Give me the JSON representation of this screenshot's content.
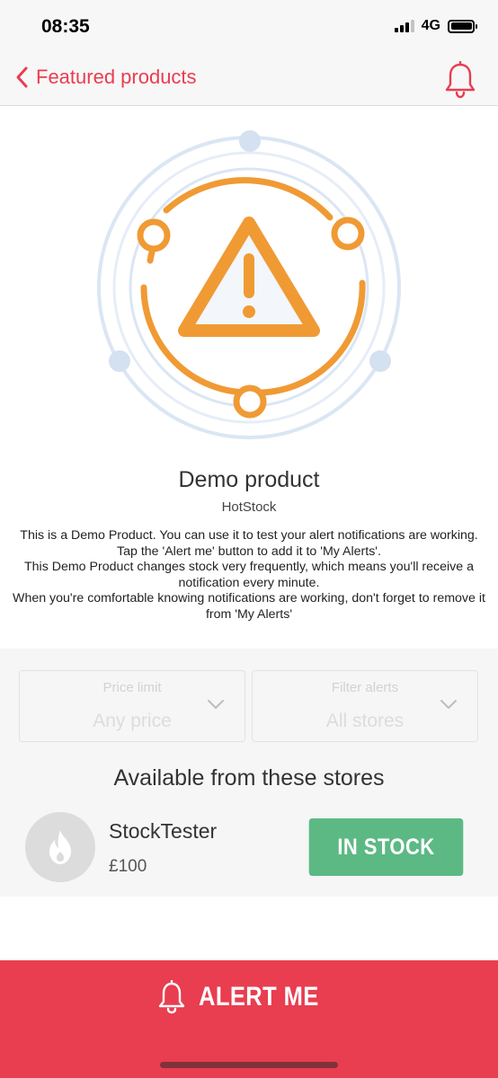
{
  "status_bar": {
    "time": "08:35",
    "network": "4G"
  },
  "nav": {
    "back_label": "Featured products",
    "back_icon": "chevron-left-icon",
    "bell_icon": "bell-icon"
  },
  "hero": {
    "icon": "warning-triangle-icon",
    "accent_color": "#f09a34",
    "ring_color": "#dbe6f4"
  },
  "product": {
    "title": "Demo product",
    "brand": "HotStock",
    "description_lines": [
      "This is a Demo Product. You can use it to test your alert notifications are working.",
      "Tap the 'Alert me' button to add it to 'My Alerts'.",
      "This Demo Product changes stock very frequently, which means you'll receive a notification every minute.",
      "When you're comfortable knowing notifications are working, don't forget to remove it from 'My Alerts'"
    ]
  },
  "filters": {
    "price": {
      "label": "Price limit",
      "value": "Any price"
    },
    "stores": {
      "label": "Filter alerts",
      "value": "All stores"
    }
  },
  "stores_section": {
    "title": "Available from these stores",
    "stores": [
      {
        "name": "StockTester",
        "price": "£100",
        "status": "IN STOCK",
        "status_color": "#5cb984",
        "icon": "flame-icon"
      }
    ]
  },
  "alert_button": {
    "label": "ALERT ME",
    "icon": "bell-icon",
    "color": "#e93d50"
  }
}
